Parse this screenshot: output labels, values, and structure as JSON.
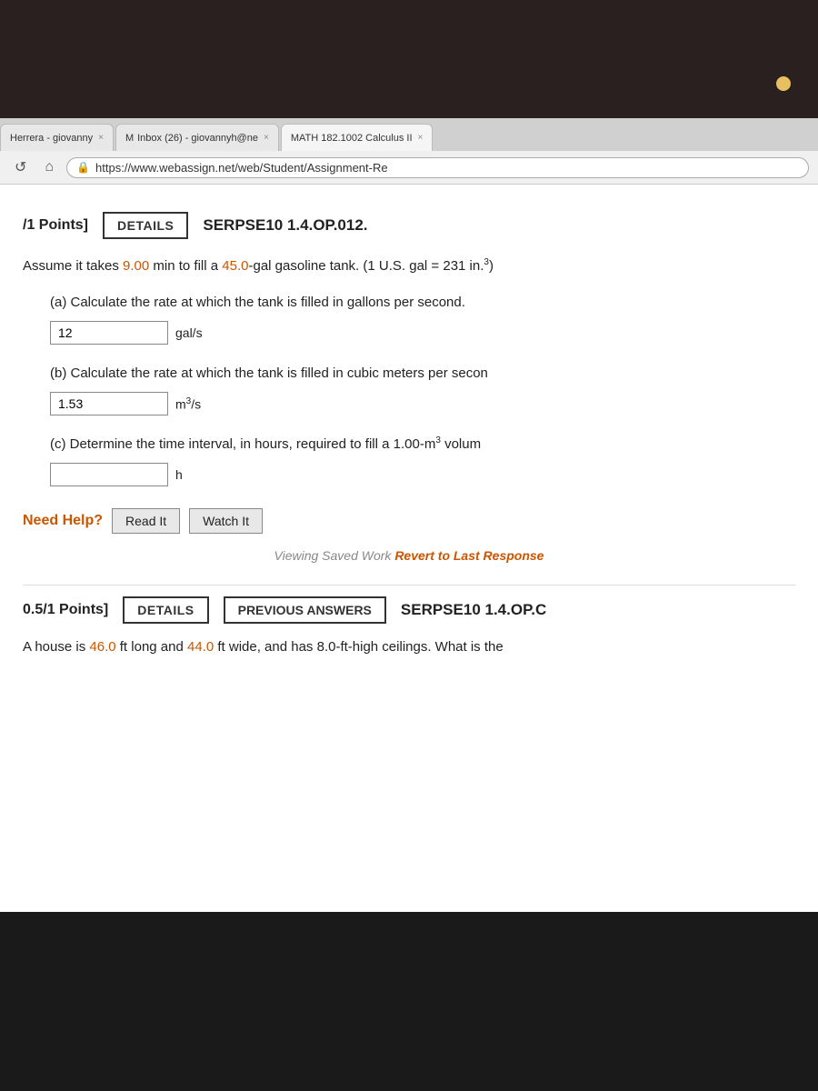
{
  "browser": {
    "tabs": [
      {
        "label": "Herrera - giovanny",
        "active": false,
        "close": "×"
      },
      {
        "label": "M  Inbox (26) - giovannyh@ne",
        "active": false,
        "icon": "M",
        "close": "×"
      },
      {
        "label": "MATH 182.1002 Calculus II",
        "active": true,
        "close": "×"
      }
    ],
    "url": "https://www.webassign.net/web/Student/Assignment-Re",
    "nav": {
      "reload": "↺",
      "home": "⌂"
    }
  },
  "problem1": {
    "points": "/1 Points]",
    "details_btn": "DETAILS",
    "problem_id": "SERPSE10 1.4.OP.012.",
    "problem_text_prefix": "Assume it takes ",
    "time_value": "9.00",
    "time_unit": " min to fill a ",
    "volume_value": "45.0",
    "problem_text_suffix": "-gal gasoline tank. (1 U.S. gal = 231 in.",
    "superscript": "3",
    "problem_text_end": ")",
    "part_a_label": "(a) Calculate the rate at which the tank is filled in gallons per second.",
    "part_a_value": "12",
    "part_a_unit": "gal/s",
    "part_b_label": "(b) Calculate the rate at which the tank is filled in cubic meters per secon",
    "part_b_value": "1.53",
    "part_b_unit_prefix": "m",
    "part_b_sup": "3",
    "part_b_unit_suffix": "/s",
    "part_c_label": "(c) Determine the time interval, in hours, required to fill a 1.00-m",
    "part_c_sup": "3",
    "part_c_label_suffix": " volum",
    "part_c_unit": "h",
    "part_c_value": "",
    "need_help_text": "Need Help?",
    "read_btn": "Read It",
    "watch_btn": "Watch It",
    "viewing_text": "Viewing Saved Work ",
    "revert_text": "Revert to Last Response"
  },
  "problem2": {
    "points": "0.5/1 Points]",
    "details_btn": "DETAILS",
    "previous_answers_btn": "PREVIOUS ANSWERS",
    "problem_id": "SERPSE10 1.4.OP.C",
    "problem_text_prefix": "A house is ",
    "val1": "46.0",
    "text2": " ft long and ",
    "val2": "44.0",
    "text3": " ft wide, and has 8.0-ft-high ceilings. What is the",
    "problem_text_truncated": "A house is 46.0 ft long and 44.0 ft wide, and has 8.0-ft-high ceilings. What is the"
  }
}
